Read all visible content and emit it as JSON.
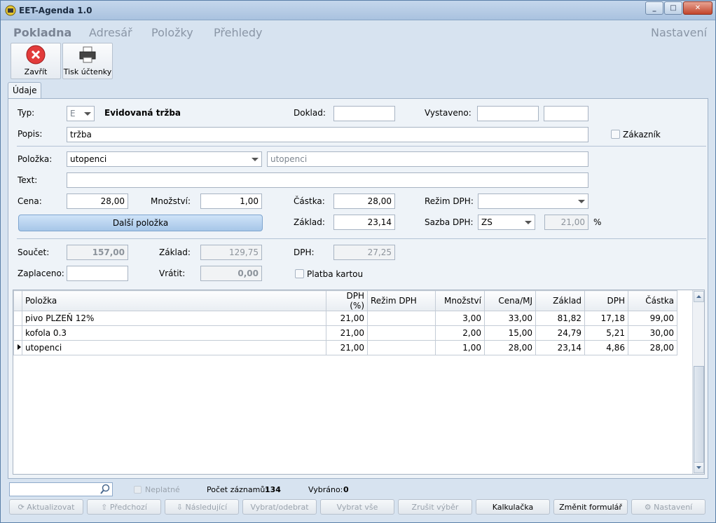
{
  "window": {
    "title": "EET-Agenda 1.0",
    "min": "_",
    "max": "□",
    "close": "✕"
  },
  "menu": {
    "pokladna": "Pokladna",
    "adresar": "Adresář",
    "polozky": "Položky",
    "prehledy": "Přehledy",
    "nastaveni": "Nastavení"
  },
  "toolbar": {
    "close": "Zavřít",
    "print": "Tisk účtenky"
  },
  "tab": "Údaje",
  "form": {
    "typ_label": "Typ:",
    "typ_value": "E",
    "typ_desc": "Evidovaná tržba",
    "doklad_label": "Doklad:",
    "vystaveno_label": "Vystaveno:",
    "popis_label": "Popis:",
    "popis_value": "tržba",
    "zakaznik_label": "Zákazník",
    "polozka_label": "Položka:",
    "polozka_value": "utopenci",
    "polozka_name": "utopenci",
    "text_label": "Text:",
    "cena_label": "Cena:",
    "cena_value": "28,00",
    "mnozstvi_label": "Množství:",
    "mnozstvi_value": "1,00",
    "castka_label": "Částka:",
    "castka_value": "28,00",
    "rezim_label": "Režim DPH:",
    "dalsi_button": "Další položka",
    "zaklad_label": "Základ:",
    "zaklad_value": "23,14",
    "sazba_label": "Sazba DPH:",
    "sazba_value": "ZS",
    "sazba_pct": "21,00",
    "pct": "%",
    "soucet_label": "Součet:",
    "soucet_value": "157,00",
    "zaklad2_label": "Základ:",
    "zaklad2_value": "129,75",
    "dph_label": "DPH:",
    "dph_value": "27,25",
    "zaplaceno_label": "Zaplaceno:",
    "vratit_label": "Vrátit:",
    "vratit_value": "0,00",
    "platba_label": "Platba kartou"
  },
  "grid": {
    "columns": [
      "Položka",
      "DPH (%)",
      "Režim DPH",
      "Množství",
      "Cena/MJ",
      "Základ",
      "DPH",
      "Částka"
    ],
    "rows": [
      [
        "pivo PLZEŇ 12%",
        "21,00",
        "",
        "3,00",
        "33,00",
        "81,82",
        "17,18",
        "99,00"
      ],
      [
        "kofola 0.3",
        "21,00",
        "",
        "2,00",
        "15,00",
        "24,79",
        "5,21",
        "30,00"
      ],
      [
        "utopenci",
        "21,00",
        "",
        "1,00",
        "28,00",
        "23,14",
        "4,86",
        "28,00"
      ]
    ]
  },
  "status": {
    "neplatne": "Neplatné",
    "pocet_label": "Počet záznamů:",
    "pocet_value": "134",
    "vybrano_label": "Vybráno:",
    "vybrano_value": "0"
  },
  "bottom": {
    "aktualizovat": "Aktualizovat",
    "predchozi": "Předchozí",
    "nasledujici": "Následující",
    "vybrat_odebrat": "Vybrat/odebrat",
    "vybrat_vse": "Vybrat vše",
    "zrusit": "Zrušit výběr",
    "kalkulacka": "Kalkulačka",
    "zmenit": "Změnit formulář",
    "nastaveni": "Nastavení"
  }
}
